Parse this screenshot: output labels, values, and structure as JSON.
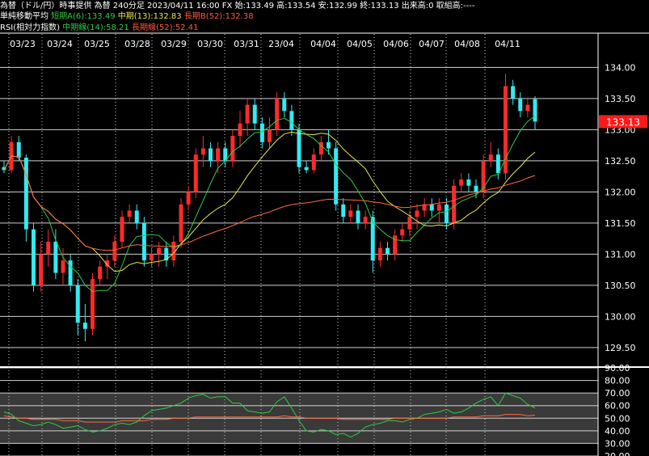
{
  "header": {
    "line1": "為替（ドル/円）時事提供 為替 240分足 2023/04/11 16:00 FX 始:133.49 高:133.54 安:132.99 終:133.13 出来高:0 取組高:----",
    "ma_label": "単純移動平均",
    "ma_short": "短期A(6):133.49",
    "ma_mid": "中期(13):132.83",
    "ma_long": "長期B(52):132.38",
    "rsi_label": "RSI(相対力指数)",
    "rsi_mid": "中期線(14):58.21",
    "rsi_long": "長期線(52):52.41"
  },
  "price_tag": "133.13",
  "colors": {
    "up": "#ff2a2a",
    "down": "#33eaf2",
    "ma_short": "#2ecc40",
    "ma_mid": "#e8e84a",
    "ma_long": "#ff6b3c",
    "rsi_mid": "#2ecc40",
    "rsi_long": "#ff6b3c"
  },
  "chart_data": [
    {
      "type": "candlestick",
      "x_labels": [
        "03/23",
        "03/24",
        "03/25",
        "03/28",
        "03/29",
        "03/30",
        "03/31",
        "23/04",
        "04/04",
        "04/05",
        "04/06",
        "04/07",
        "04/08",
        "04/11"
      ],
      "y_ticks": [
        "134.00",
        "133.50",
        "133.00",
        "132.50",
        "132.00",
        "131.50",
        "131.00",
        "130.50",
        "130.00",
        "129.50"
      ],
      "ylim": [
        129.2,
        134.2
      ],
      "ohlc": [
        [
          132.4,
          132.5,
          132.3,
          132.35
        ],
        [
          132.35,
          132.9,
          132.3,
          132.8
        ],
        [
          132.8,
          132.9,
          132.5,
          132.55
        ],
        [
          132.55,
          132.6,
          131.2,
          131.4
        ],
        [
          131.4,
          131.5,
          130.4,
          130.5
        ],
        [
          130.5,
          131.2,
          130.4,
          131.0
        ],
        [
          131.0,
          131.4,
          130.8,
          131.2
        ],
        [
          131.2,
          131.4,
          130.6,
          130.7
        ],
        [
          130.7,
          131.1,
          130.5,
          130.9
        ],
        [
          130.9,
          131.0,
          130.4,
          130.5
        ],
        [
          130.5,
          130.6,
          129.7,
          129.9
        ],
        [
          129.9,
          130.2,
          129.6,
          129.8
        ],
        [
          129.8,
          130.7,
          129.7,
          130.6
        ],
        [
          130.6,
          130.9,
          130.5,
          130.8
        ],
        [
          130.8,
          131.0,
          130.6,
          130.9
        ],
        [
          130.9,
          131.3,
          130.8,
          131.2
        ],
        [
          131.2,
          131.7,
          131.1,
          131.6
        ],
        [
          131.6,
          131.8,
          131.5,
          131.7
        ],
        [
          131.7,
          131.8,
          131.4,
          131.5
        ],
        [
          131.5,
          131.6,
          130.8,
          130.9
        ],
        [
          130.9,
          131.1,
          130.8,
          131.0
        ],
        [
          131.0,
          131.2,
          130.8,
          131.1
        ],
        [
          131.1,
          131.2,
          130.8,
          130.9
        ],
        [
          130.9,
          131.3,
          130.8,
          131.2
        ],
        [
          131.2,
          131.9,
          131.1,
          131.8
        ],
        [
          131.8,
          132.1,
          131.7,
          132.0
        ],
        [
          132.0,
          132.7,
          131.9,
          132.6
        ],
        [
          132.6,
          132.9,
          132.4,
          132.7
        ],
        [
          132.7,
          132.8,
          132.4,
          132.5
        ],
        [
          132.5,
          132.8,
          132.3,
          132.7
        ],
        [
          132.7,
          132.8,
          132.4,
          132.5
        ],
        [
          132.5,
          133.0,
          132.4,
          132.9
        ],
        [
          132.9,
          133.3,
          132.7,
          133.1
        ],
        [
          133.1,
          133.5,
          132.9,
          133.4
        ],
        [
          133.4,
          133.5,
          133.0,
          133.1
        ],
        [
          133.1,
          133.2,
          132.7,
          132.8
        ],
        [
          132.8,
          133.2,
          132.7,
          133.0
        ],
        [
          133.0,
          133.6,
          132.9,
          133.5
        ],
        [
          133.5,
          133.6,
          133.2,
          133.3
        ],
        [
          133.3,
          133.4,
          132.9,
          133.0
        ],
        [
          133.0,
          133.1,
          132.3,
          132.4
        ],
        [
          132.4,
          132.5,
          132.3,
          132.35
        ],
        [
          132.35,
          132.7,
          132.3,
          132.6
        ],
        [
          132.6,
          132.9,
          132.5,
          132.8
        ],
        [
          132.8,
          133.0,
          132.6,
          132.7
        ],
        [
          132.7,
          132.8,
          131.7,
          131.8
        ],
        [
          131.8,
          131.9,
          131.5,
          131.6
        ],
        [
          131.6,
          131.8,
          131.5,
          131.7
        ],
        [
          131.7,
          131.8,
          131.4,
          131.5
        ],
        [
          131.5,
          131.7,
          131.4,
          131.6
        ],
        [
          131.6,
          131.7,
          130.7,
          130.9
        ],
        [
          130.9,
          131.2,
          130.8,
          131.1
        ],
        [
          131.1,
          131.2,
          130.9,
          131.0
        ],
        [
          131.0,
          131.4,
          130.9,
          131.3
        ],
        [
          131.3,
          131.5,
          131.2,
          131.4
        ],
        [
          131.4,
          131.7,
          131.3,
          131.6
        ],
        [
          131.6,
          131.8,
          131.4,
          131.7
        ],
        [
          131.7,
          131.9,
          131.6,
          131.8
        ],
        [
          131.8,
          131.9,
          131.6,
          131.7
        ],
        [
          131.7,
          131.9,
          131.5,
          131.8
        ],
        [
          131.8,
          131.9,
          131.4,
          131.5
        ],
        [
          131.5,
          132.2,
          131.4,
          132.1
        ],
        [
          132.1,
          132.3,
          132.0,
          132.2
        ],
        [
          132.2,
          132.3,
          132.0,
          132.1
        ],
        [
          132.1,
          132.2,
          131.9,
          132.0
        ],
        [
          132.0,
          132.6,
          131.9,
          132.5
        ],
        [
          132.5,
          132.8,
          132.4,
          132.6
        ],
        [
          132.6,
          132.7,
          132.2,
          132.3
        ],
        [
          132.3,
          133.9,
          132.2,
          133.7
        ],
        [
          133.7,
          133.8,
          133.4,
          133.5
        ],
        [
          133.5,
          133.6,
          133.2,
          133.3
        ],
        [
          133.3,
          133.5,
          133.2,
          133.4
        ],
        [
          133.49,
          133.54,
          132.99,
          133.13
        ]
      ]
    },
    {
      "type": "line",
      "title": "RSI",
      "y_ticks": [
        "90.00",
        "80.00",
        "70.00",
        "60.00",
        "50.00",
        "40.00",
        "30.00",
        "20.00"
      ],
      "ylim": [
        20,
        90
      ],
      "series": [
        {
          "name": "中期線(14)",
          "values": [
            55,
            53,
            48,
            46,
            44,
            45,
            47,
            45,
            42,
            43,
            44,
            41,
            39,
            40,
            42,
            45,
            46,
            45,
            47,
            52,
            56,
            57,
            58,
            60,
            62,
            66,
            68,
            69,
            66,
            67,
            67,
            62,
            62,
            56,
            55,
            54,
            55,
            63,
            67,
            58,
            48,
            40,
            39,
            41,
            40,
            37,
            38,
            35,
            38,
            43,
            45,
            46,
            48,
            48,
            47,
            49,
            50,
            53,
            54,
            55,
            57,
            54,
            55,
            58,
            62,
            65,
            67,
            60,
            70,
            68,
            66,
            61,
            58.21
          ]
        },
        {
          "name": "長期線(52)",
          "values": [
            52,
            51,
            50,
            50,
            49,
            49,
            49,
            49,
            48,
            48,
            48,
            47,
            47,
            47,
            47,
            47,
            48,
            48,
            48,
            48,
            49,
            49,
            49,
            50,
            50,
            50,
            51,
            51,
            51,
            51,
            51,
            51,
            51,
            51,
            51,
            51,
            51,
            51,
            52,
            51,
            51,
            50,
            50,
            50,
            50,
            50,
            49,
            49,
            49,
            49,
            49,
            49,
            49,
            50,
            50,
            50,
            50,
            50,
            50,
            50,
            50,
            51,
            51,
            51,
            51,
            52,
            52,
            52,
            53,
            53,
            53,
            52,
            52.41
          ]
        }
      ]
    }
  ]
}
